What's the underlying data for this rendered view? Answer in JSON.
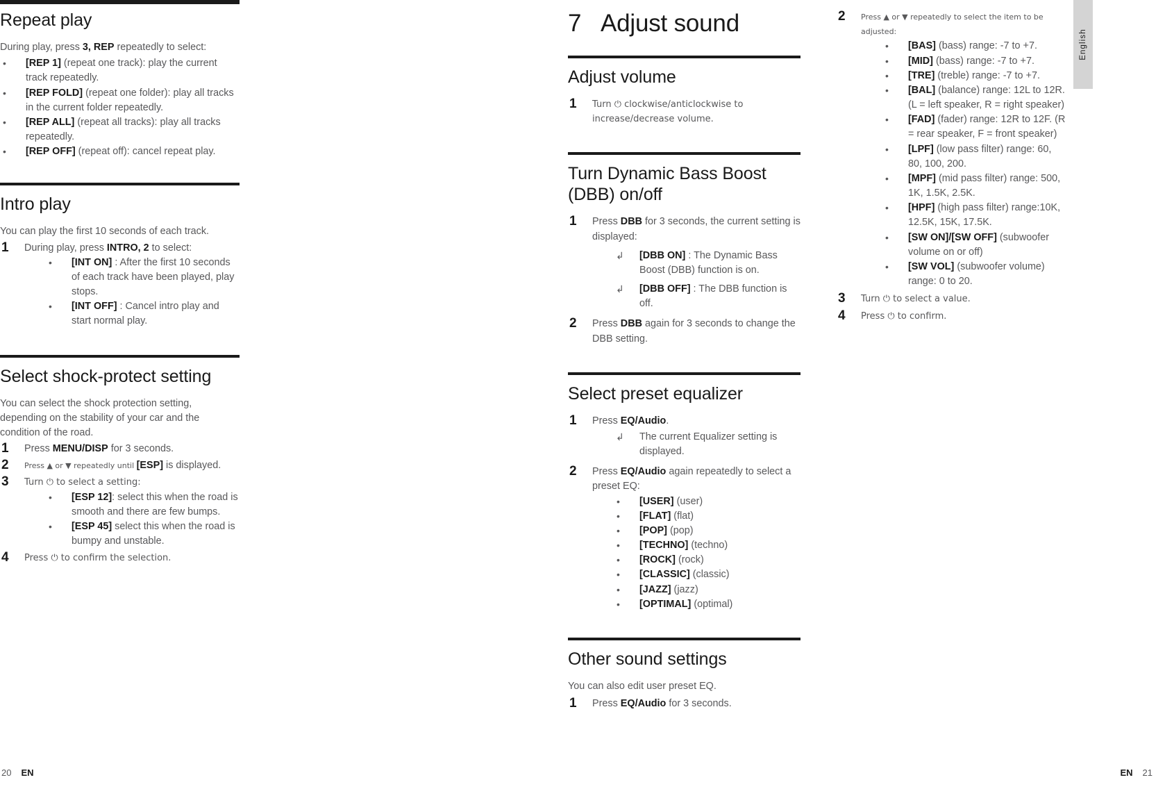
{
  "document": {
    "language_tab": "English",
    "footer_left": {
      "page": "20",
      "lang": "EN"
    },
    "footer_right": {
      "lang": "EN",
      "page": "21"
    }
  },
  "left_column": {
    "sections": [
      {
        "id": "repeat-play",
        "heading": "Repeat play",
        "intro_pre": "During play, press ",
        "intro_bold": "3, REP",
        "intro_post": " repeatedly to select:",
        "bullets": [
          {
            "bold": "[REP 1]",
            "rest": " (repeat one track): play the current track repeatedly."
          },
          {
            "bold": "[REP FOLD]",
            "rest": " (repeat one folder): play all tracks in the current folder repeatedly."
          },
          {
            "bold": "[REP ALL]",
            "rest": " (repeat all tracks): play all tracks repeatedly."
          },
          {
            "bold": "[REP OFF]",
            "rest": " (repeat off): cancel repeat play."
          }
        ]
      },
      {
        "id": "intro-play",
        "heading": "Intro play",
        "intro": "You can play the first 10 seconds of each track.",
        "step_num": "1",
        "step_pre": "During play, press ",
        "step_bold": "INTRO, 2",
        "step_post": " to select:",
        "bullets": [
          {
            "bold": "[INT ON]",
            "rest": " : After the first 10 seconds of each track have been played, play stops."
          },
          {
            "bold": "[INT OFF]",
            "rest": " : Cancel intro play and start normal play."
          }
        ]
      },
      {
        "id": "shock-protect",
        "heading": "Select shock-protect setting",
        "intro": "You can select the shock protection setting, depending on the stability of your car and the condition of the road.",
        "steps": [
          {
            "num": "1",
            "pre": "Press ",
            "bold": "MENU/DISP",
            "post": " for 3 seconds."
          },
          {
            "num": "2",
            "pre": "Press ▲ or ▼ repeatedly until ",
            "bold": "[ESP]",
            "post": " is displayed."
          },
          {
            "num": "3",
            "pre": "Turn ⏻ to select a setting:",
            "bold": "",
            "post": "",
            "bullets": [
              {
                "bold": "[ESP 12]",
                "rest": ": select this when the road is smooth and there are few bumps."
              },
              {
                "bold": "[ESP 45]",
                "rest": " select this when the road is bumpy and unstable."
              }
            ]
          },
          {
            "num": "4",
            "pre": "Press ⏻ to confirm the selection.",
            "bold": "",
            "post": ""
          }
        ]
      }
    ]
  },
  "middle_column": {
    "chapter": {
      "number": "7",
      "title": "Adjust sound"
    },
    "sections": [
      {
        "id": "adjust-volume",
        "heading": "Adjust volume",
        "steps": [
          {
            "num": "1",
            "text": "Turn ⏻ clockwise/anticlockwise to increase/decrease volume."
          }
        ]
      },
      {
        "id": "dbb",
        "heading": "Turn Dynamic Bass Boost (DBB) on/off",
        "steps": [
          {
            "num": "1",
            "pre": "Press ",
            "bold": "DBB",
            "post": " for 3 seconds, the current setting is displayed:",
            "arrows": [
              {
                "bold": "[DBB ON]",
                "rest": " : The Dynamic Bass Boost (DBB) function is on."
              },
              {
                "bold": "[DBB OFF]",
                "rest": " : The DBB function is off."
              }
            ]
          },
          {
            "num": "2",
            "pre": "Press ",
            "bold": "DBB",
            "post": " again for 3 seconds to change the DBB setting."
          }
        ]
      },
      {
        "id": "preset-eq",
        "heading": "Select preset equalizer",
        "steps": [
          {
            "num": "1",
            "pre": "Press ",
            "bold": "EQ/Audio",
            "post": ".",
            "arrows": [
              {
                "bold": "",
                "rest": "The current Equalizer setting is displayed."
              }
            ]
          },
          {
            "num": "2",
            "pre": "Press ",
            "bold": "EQ/Audio",
            "post": " again repeatedly to select a preset EQ:",
            "bullets": [
              {
                "bold": "[USER]",
                "rest": " (user)"
              },
              {
                "bold": "[FLAT]",
                "rest": " (flat)"
              },
              {
                "bold": "[POP]",
                "rest": " (pop)"
              },
              {
                "bold": "[TECHNO]",
                "rest": " (techno)"
              },
              {
                "bold": "[ROCK]",
                "rest": " (rock)"
              },
              {
                "bold": "[CLASSIC]",
                "rest": " (classic)"
              },
              {
                "bold": "[JAZZ]",
                "rest": " (jazz)"
              },
              {
                "bold": "[OPTIMAL]",
                "rest": " (optimal)"
              }
            ]
          }
        ]
      },
      {
        "id": "other-sound",
        "heading": "Other sound settings",
        "intro": "You can also edit user preset EQ.",
        "steps": [
          {
            "num": "1",
            "pre": "Press ",
            "bold": "EQ/Audio",
            "post": " for 3 seconds."
          }
        ]
      }
    ]
  },
  "right_column": {
    "steps": [
      {
        "num": "2",
        "text": "Press ▲ or ▼ repeatedly to select the item to be adjusted:",
        "bullets": [
          {
            "bold": "[BAS]",
            "rest": " (bass) range: -7 to +7."
          },
          {
            "bold": "[MID]",
            "rest": " (bass) range: -7 to +7."
          },
          {
            "bold": "[TRE]",
            "rest": " (treble) range: -7 to +7."
          },
          {
            "bold": "[BAL]",
            "rest": " (balance) range: 12L to 12R. (L = left speaker, R = right speaker)"
          },
          {
            "bold": "[FAD]",
            "rest": " (fader) range: 12R to 12F. (R = rear speaker, F = front speaker)"
          },
          {
            "bold": "[LPF]",
            "rest": " (low pass filter) range: 60, 80, 100, 200."
          },
          {
            "bold": "[MPF]",
            "rest": " (mid pass filter) range: 500, 1K, 1.5K, 2.5K."
          },
          {
            "bold": "[HPF]",
            "rest": " (high pass filter) range:10K, 12.5K, 15K, 17.5K."
          },
          {
            "bold": "[SW ON]/[SW OFF]",
            "rest": " (subwoofer volume on or off)"
          },
          {
            "bold": "[SW VOL]",
            "rest": " (subwoofer volume) range: 0 to 20."
          }
        ]
      },
      {
        "num": "3",
        "text": "Turn ⏻ to select a value."
      },
      {
        "num": "4",
        "text": "Press ⏻ to confirm."
      }
    ]
  }
}
